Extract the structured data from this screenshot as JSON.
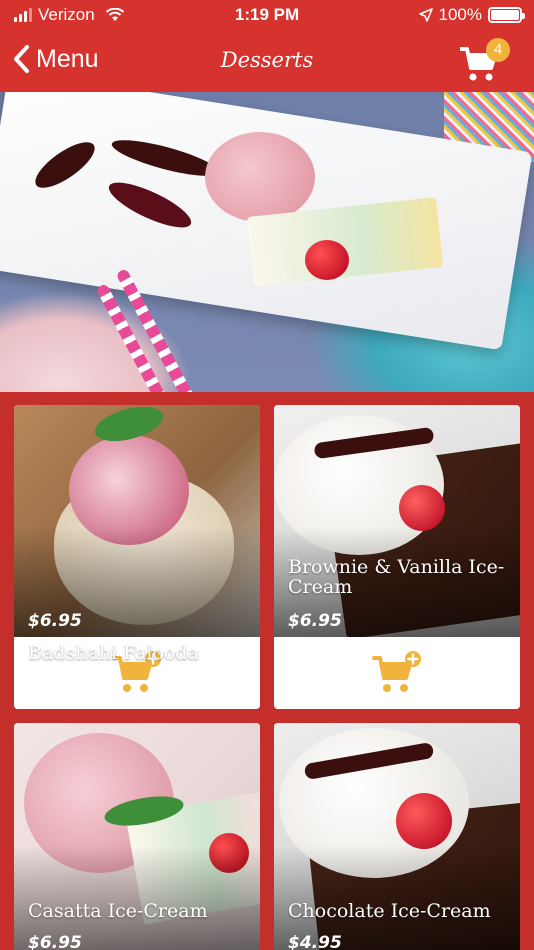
{
  "status_bar": {
    "carrier": "Verizon",
    "time": "1:19 PM",
    "battery": "100%"
  },
  "nav": {
    "back_label": "Menu",
    "title": "Desserts",
    "cart_count": "4"
  },
  "products": [
    {
      "name": "Badshahi Falooda",
      "price": "$6.95"
    },
    {
      "name": "Brownie & Vanilla Ice-Cream",
      "price": "$6.95"
    },
    {
      "name": "Casatta Ice-Cream",
      "price": "$6.95"
    },
    {
      "name": "Chocolate Ice-Cream",
      "price": "$4.95"
    }
  ],
  "icons": {
    "back": "chevron-left-icon",
    "cart": "shopping-cart-icon",
    "add_to_cart": "cart-plus-icon"
  },
  "colors": {
    "header": "#d6322e",
    "background": "#c42f2b",
    "badge": "#f0b43c",
    "add_icon": "#f0b43c"
  }
}
